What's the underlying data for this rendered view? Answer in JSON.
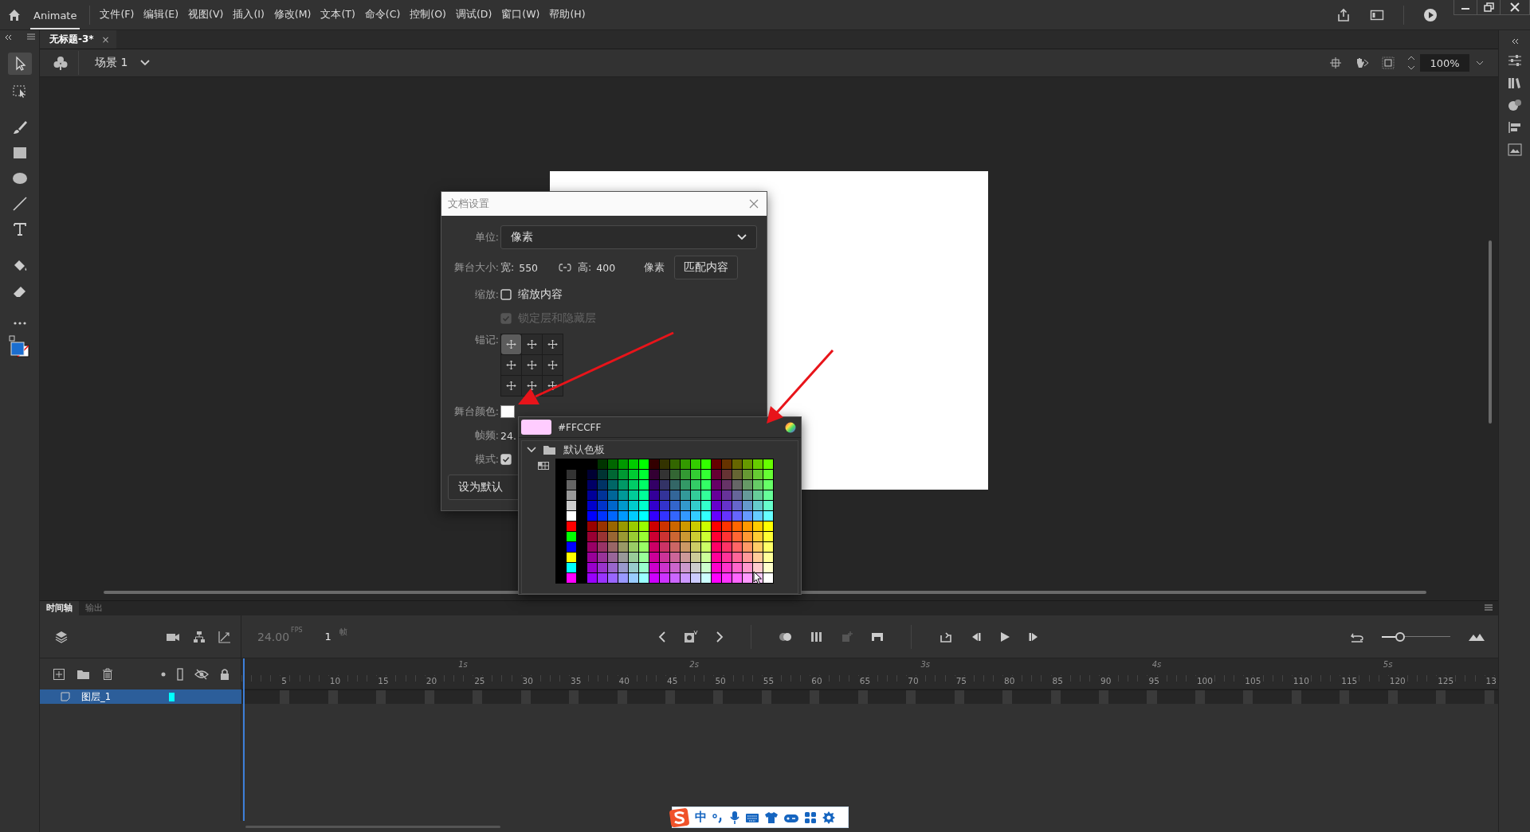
{
  "app": {
    "name": "Animate"
  },
  "menu": [
    "文件(F)",
    "编辑(E)",
    "视图(V)",
    "插入(I)",
    "修改(M)",
    "文本(T)",
    "命令(C)",
    "控制(O)",
    "调试(D)",
    "窗口(W)",
    "帮助(H)"
  ],
  "document_tabs": [
    {
      "label": "无标题-3*",
      "close": "×",
      "selected": true
    }
  ],
  "scene": {
    "label": "场景 1"
  },
  "zoom": {
    "value": "100%"
  },
  "stage": {
    "color": "#ffffff"
  },
  "dialog": {
    "title": "文档设置",
    "units_label": "单位:",
    "units_value": "像素",
    "stage_size_label": "舞台大小:",
    "width_label": "宽:",
    "width_value": "550",
    "height_label": "高:",
    "height_value": "400",
    "size_unit": "像素",
    "match_button": "匹配内容",
    "scale_label": "缩放:",
    "checkboxes": [
      {
        "label": "缩放内容",
        "checked": false,
        "disabled": false
      },
      {
        "label": "锁定层和隐藏层",
        "checked": true,
        "disabled": true
      }
    ],
    "anchor_label": "锚记:",
    "anchors": [
      {
        "selected": true
      },
      {
        "selected": false
      },
      {
        "selected": false
      },
      {
        "selected": false
      },
      {
        "selected": false
      },
      {
        "selected": false
      },
      {
        "selected": false
      },
      {
        "selected": false
      },
      {
        "selected": false
      }
    ],
    "stage_color_label": "舞台颜色:",
    "fps_label": "帧频:",
    "fps_value": "24.",
    "mode_label": "模式:",
    "mode_checked": true,
    "default_button": "设为默认"
  },
  "color_popup": {
    "preview": {
      "color": "#ffccff"
    },
    "hex": "#FFCCFF",
    "folders": [
      {
        "label": "默认色板",
        "expanded": true
      }
    ]
  },
  "timeline": {
    "tabs": [
      {
        "label": "时间轴",
        "selected": true
      },
      {
        "label": "输出",
        "selected": false
      }
    ],
    "fps": "24.00",
    "fps_unit": "FPS",
    "frame": "1",
    "frame_unit": "帧",
    "zoom_slider": {
      "level": 0.25
    },
    "seconds": [
      "1s",
      "2s",
      "3s",
      "4s",
      "5s"
    ],
    "frame_numbers": [
      "5",
      "10",
      "15",
      "20",
      "25",
      "30",
      "35",
      "40",
      "45",
      "50",
      "55",
      "60",
      "65",
      "70",
      "75",
      "80",
      "85",
      "90",
      "95",
      "100",
      "105",
      "110",
      "115",
      "120",
      "125",
      "13"
    ],
    "layers": [
      {
        "name": "图层_1",
        "selected": true,
        "color": "#00ffff"
      }
    ]
  },
  "ime": {
    "mode": "中"
  }
}
